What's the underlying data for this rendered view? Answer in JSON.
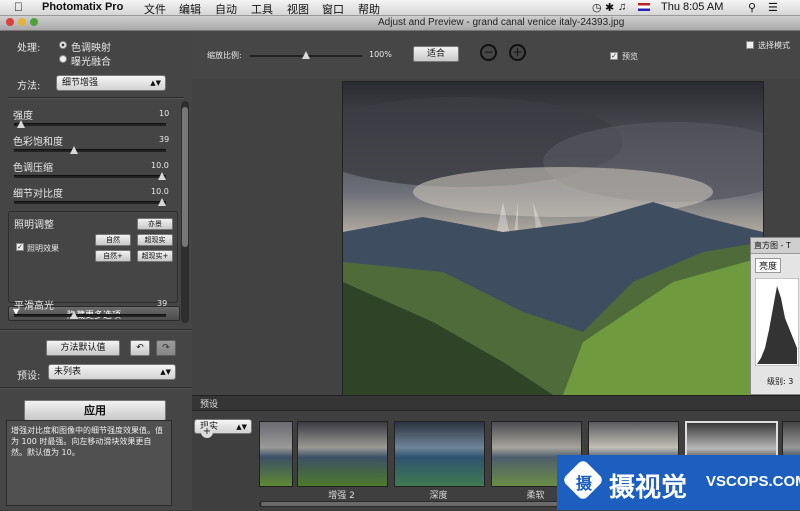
{
  "menubar": {
    "app": "Photomatix Pro",
    "items": [
      "文件",
      "编辑",
      "自动",
      "工具",
      "视图",
      "窗口",
      "帮助"
    ],
    "clock": "Thu 8:05 AM"
  },
  "window": {
    "title": "Adjust and Preview - grand canal venice italy-24393.jpg"
  },
  "left": {
    "process_label": "处理:",
    "radio_tonemap": "色调映射",
    "radio_fusion": "曝光融合",
    "method_label": "方法:",
    "method_value": "细节增强",
    "sliders": [
      {
        "label": "强度",
        "value": "10",
        "level": 0.02
      },
      {
        "label": "色彩饱和度",
        "value": "39",
        "level": 0.39
      },
      {
        "label": "色调压缩",
        "value": "10.0",
        "level": 1.0
      },
      {
        "label": "细节对比度",
        "value": "10.0",
        "level": 1.0
      }
    ],
    "lighting_title": "照明调整",
    "lighting_btn_top": "亦景",
    "lighting_btn_natural": "自然",
    "lighting_btn_surreal": "超现实",
    "lighting_btn_natural_plus": "自然+",
    "lighting_btn_surreal_plus": "超现实+",
    "lighting_check": "照明效果",
    "more_options": "隐藏更多选项",
    "smooth_label": "平滑高光",
    "smooth_value": "39",
    "smooth_level": 0.39,
    "defaults_btn": "方法默认值",
    "preset_label": "预设:",
    "preset_value": "未列表",
    "apply_btn": "应用",
    "help_text": "增强对比度和图像中的细节强度效果值。值为 100 时最强。向左移动滑块效果更自然。默认值为 10。"
  },
  "toolbar": {
    "zoom_label": "缩放比例:",
    "zoom_value": "100%",
    "zoom_level": 0.5,
    "fit_btn": "适合",
    "preview_label": "预览",
    "select_mode": "选择模式"
  },
  "histogram": {
    "title": "直方图 - T",
    "tab": "亮度",
    "level_label": "级别: 3"
  },
  "presets": {
    "header": "预设",
    "dropdown": "现实",
    "thumbs": [
      "增强 2",
      "深度",
      "柔软",
      "",
      ""
    ]
  },
  "watermark": {
    "name": "摄视觉",
    "domain": "VSCOPS.COM"
  },
  "colors": {
    "panel": "#454545",
    "accent": "#1c5fbf"
  }
}
